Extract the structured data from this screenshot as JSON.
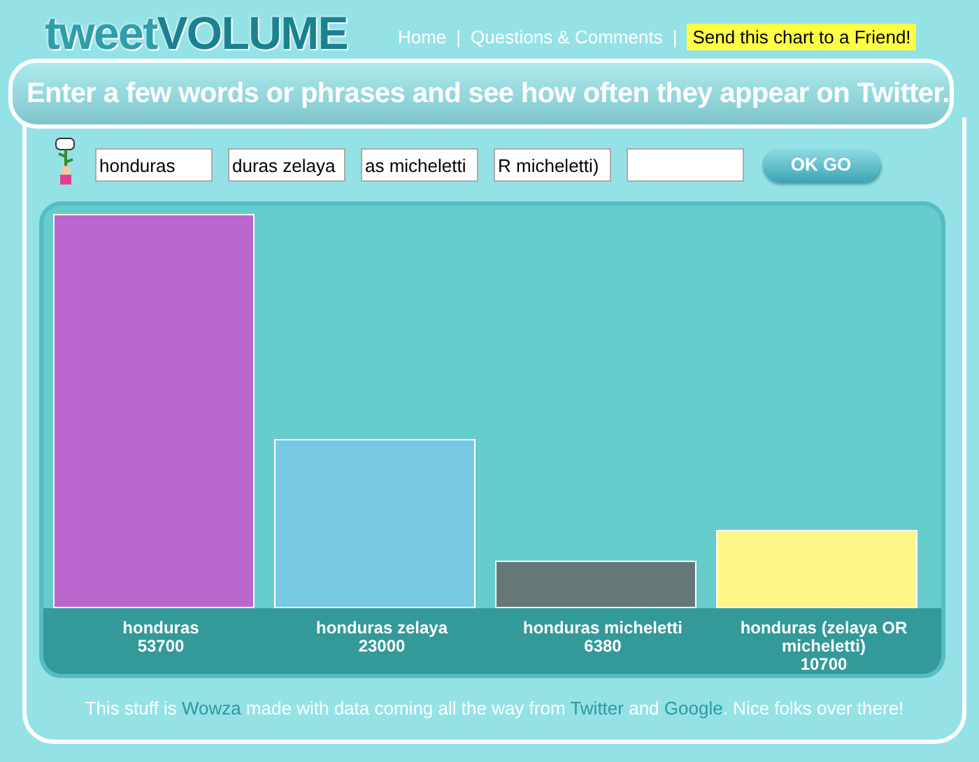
{
  "logo": {
    "part_1": "tweet",
    "part_2": "VOLUME"
  },
  "nav": [
    {
      "label": "Home",
      "kind": "link"
    },
    {
      "label": "|",
      "kind": "separator"
    },
    {
      "label": "Questions & Comments",
      "kind": "link"
    },
    {
      "label": "|",
      "kind": "separator"
    },
    {
      "label": "Send this chart to a Friend!",
      "kind": "highlight"
    }
  ],
  "prompt": "Enter a few words or phrases and see how often they appear on Twitter.",
  "fields": [
    {
      "value": "honduras"
    },
    {
      "value": "duras zelaya"
    },
    {
      "value": "as micheletti"
    },
    {
      "value": "R micheletti)"
    }
  ],
  "submit_button": "OK GO",
  "chart_data": {
    "type": "bar",
    "categories": [
      "honduras",
      "honduras zelaya",
      "honduras micheletti",
      "honduras (zelaya OR micheletti)"
    ],
    "values": [
      53700,
      23000,
      6380,
      10700
    ],
    "data_labels": true
  },
  "footer": [
    {
      "text": "This stuff is ",
      "kind": "text"
    },
    {
      "text": "Wowza",
      "kind": "link"
    },
    {
      "text": " made with data coming all the way from ",
      "kind": "text"
    },
    {
      "text": "Twitter",
      "kind": "link"
    },
    {
      "text": " and ",
      "kind": "text"
    },
    {
      "text": "Google",
      "kind": "link"
    },
    {
      "text": ". Nice folks over there!",
      "kind": "text"
    }
  ]
}
